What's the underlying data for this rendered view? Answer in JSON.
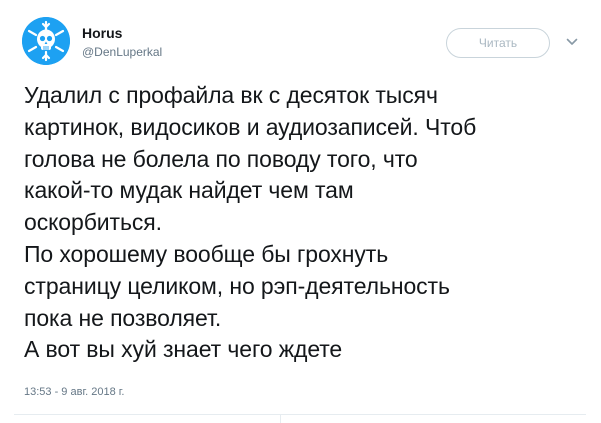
{
  "author": {
    "name": "Horus",
    "handle": "@DenLuperkal",
    "avatar_icon": "snowflake-skull-icon",
    "avatar_color": "#1da1f2"
  },
  "actions": {
    "follow_label": "Читать",
    "menu_icon": "chevron-down-icon"
  },
  "tweet": {
    "lines": [
      "Удалил с профайла вк с десяток тысяч",
      "картинок, видосиков и аудиозаписей. Чтоб",
      "голова не болела по поводу того, что",
      "какой-то мудак найдет чем там",
      "оскорбиться.",
      "По хорошему вообще бы грохнуть",
      "страницу целиком, но рэп-деятельность",
      "пока не позволяет.",
      "А вот вы хуй знает чего ждете"
    ],
    "timestamp": "13:53 - 9 авг. 2018 г."
  }
}
